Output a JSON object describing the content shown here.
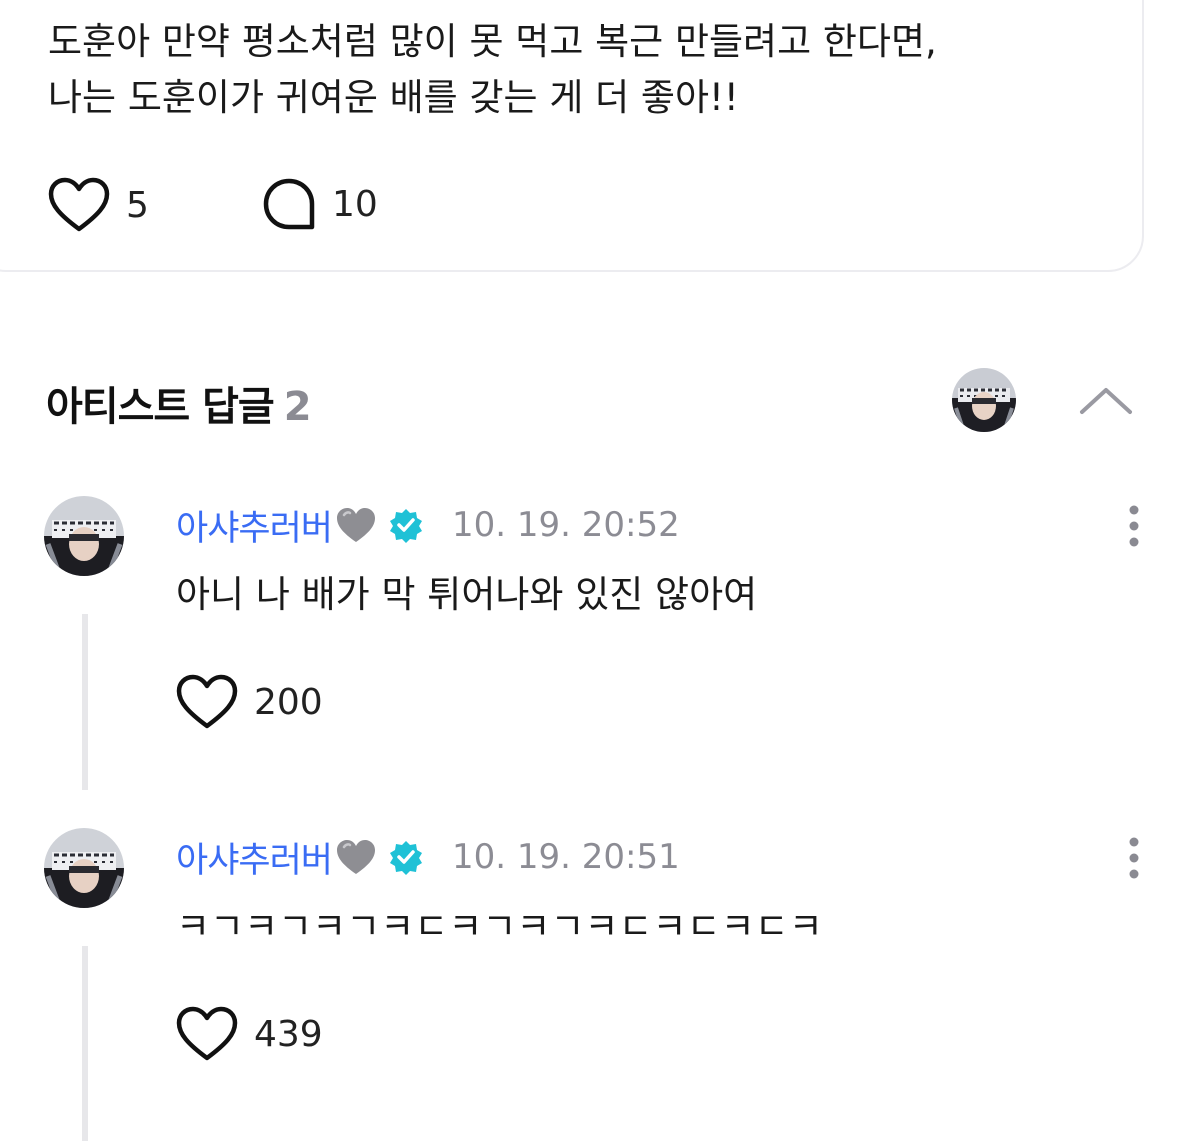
{
  "post": {
    "text_lines": [
      "도훈아 만약 평소처럼 많이 못 먹고 복근 만들려고 한다면,",
      "나는 도훈이가 귀여운 배를 갖는 게 더 좋아!!"
    ],
    "likes": "5",
    "comments": "10"
  },
  "replies": {
    "title": "아티스트 답글",
    "count": "2"
  },
  "comments": [
    {
      "author": "아샤추러버",
      "time": "10. 19. 20:52",
      "text": "아니 나 배가 막 튀어나와 있진 않아여",
      "likes": "200"
    },
    {
      "author": "아샤추러버",
      "time": "10. 19. 20:51",
      "text": "ㅋㄱㅋㄱㅋㄱㅋㄷㅋㄱㅋㄱㅋㄷㅋㄷㅋㄷㅋ",
      "likes": "439"
    }
  ],
  "colors": {
    "author_blue": "#3a6cf4",
    "verified_teal": "#1fc1d6",
    "grey_heart": "#8e8e93",
    "muted_text": "#8c8c94"
  },
  "icons": {
    "like": "heart-outline-icon",
    "comment": "speech-bubble-icon",
    "verified": "verified-badge-icon",
    "author_emoji": "grey-heart-emoji",
    "menu": "kebab-menu-icon",
    "collapse": "chevron-up-icon"
  }
}
